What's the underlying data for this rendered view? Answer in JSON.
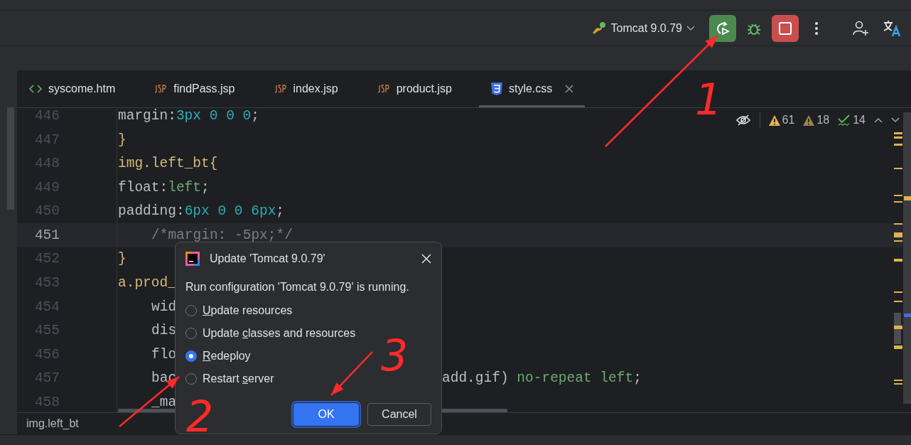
{
  "toolbar": {
    "run_config": "Tomcat 9.0.79",
    "running": true
  },
  "tabs": [
    {
      "label": "syscome.htm",
      "kind": "html",
      "selected": false
    },
    {
      "label": "findPass.jsp",
      "kind": "jsp",
      "selected": false
    },
    {
      "label": "index.jsp",
      "kind": "jsp",
      "selected": false
    },
    {
      "label": "product.jsp",
      "kind": "jsp",
      "selected": false
    },
    {
      "label": "style.css",
      "kind": "css",
      "selected": true
    }
  ],
  "inspections": [
    {
      "kind": "warning",
      "count": "61"
    },
    {
      "kind": "weak_warning",
      "count": "18"
    },
    {
      "kind": "typo",
      "count": "14"
    }
  ],
  "editor": {
    "lines": [
      {
        "number": "446",
        "current": false,
        "indent": false,
        "tokens": [
          {
            "text": "margin:",
            "kind": "plain"
          },
          {
            "text": "3px 0 0 0",
            "kind": "number"
          },
          {
            "text": ";",
            "kind": "plain"
          }
        ]
      },
      {
        "number": "447",
        "current": false,
        "indent": false,
        "tokens": [
          {
            "text": "}",
            "kind": "selector"
          }
        ]
      },
      {
        "number": "448",
        "current": false,
        "indent": false,
        "tokens": [
          {
            "text": "img.left_bt{",
            "kind": "selector"
          }
        ]
      },
      {
        "number": "449",
        "current": false,
        "indent": false,
        "tokens": [
          {
            "text": "float:",
            "kind": "plain"
          },
          {
            "text": "left",
            "kind": "value"
          },
          {
            "text": ";",
            "kind": "plain"
          }
        ]
      },
      {
        "number": "450",
        "current": false,
        "indent": false,
        "tokens": [
          {
            "text": "padding:",
            "kind": "plain"
          },
          {
            "text": "6px 0 0 6px",
            "kind": "number"
          },
          {
            "text": ";",
            "kind": "plain"
          }
        ]
      },
      {
        "number": "451",
        "current": true,
        "indent": true,
        "tokens": [
          {
            "text": "/*margin: -5px;*/",
            "kind": "comment"
          }
        ]
      },
      {
        "number": "452",
        "current": false,
        "indent": false,
        "tokens": [
          {
            "text": "}",
            "kind": "selector"
          }
        ]
      },
      {
        "number": "453",
        "current": false,
        "indent": false,
        "tokens": [
          {
            "text": "a.prod_",
            "kind": "selector"
          }
        ]
      },
      {
        "number": "454",
        "current": false,
        "indent": true,
        "tokens": [
          {
            "text": "wid",
            "kind": "plain"
          }
        ]
      },
      {
        "number": "455",
        "current": false,
        "indent": true,
        "tokens": [
          {
            "text": "dis",
            "kind": "plain"
          }
        ]
      },
      {
        "number": "456",
        "current": false,
        "indent": true,
        "tokens": [
          {
            "text": "flo",
            "kind": "plain"
          }
        ]
      },
      {
        "number": "457",
        "current": false,
        "indent": true,
        "tokens": [
          {
            "text": "bac",
            "kind": "plain"
          }
        ],
        "tail": [
          {
            "text": "add.gif)",
            "kind": "plain"
          },
          {
            "text": " no-repeat left",
            "kind": "value"
          },
          {
            "text": ";",
            "kind": "plain"
          }
        ]
      },
      {
        "number": "458",
        "current": false,
        "indent": true,
        "tokens": [
          {
            "text": "_ma",
            "kind": "plain"
          }
        ]
      }
    ]
  },
  "breadcrumb": "img.left_bt",
  "dialog": {
    "title": "Update 'Tomcat 9.0.79'",
    "message": "Run configuration 'Tomcat 9.0.79' is running.",
    "options": [
      {
        "key": "U",
        "after": "pdate resources",
        "selected": false
      },
      {
        "before": "Update ",
        "key": "c",
        "after": "lasses and resources",
        "selected": false
      },
      {
        "key": "R",
        "after": "edeploy",
        "selected": true
      },
      {
        "before": "Restart ",
        "key": "s",
        "after": "erver",
        "selected": false
      }
    ],
    "ok": "OK",
    "cancel": "Cancel"
  },
  "annotations": [
    {
      "label": "1"
    },
    {
      "label": "2"
    },
    {
      "label": "3"
    }
  ]
}
